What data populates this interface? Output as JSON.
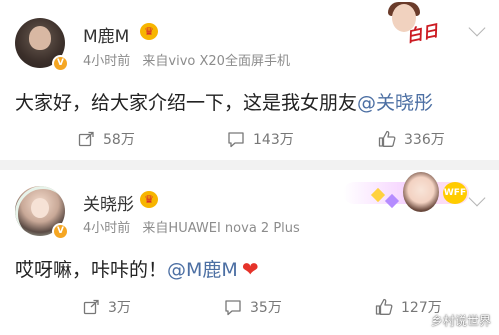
{
  "posts": [
    {
      "username": "M鹿M",
      "time": "4小时前",
      "source": "来自vivo X20全面屏手机",
      "content_text": "大家好，给大家介绍一下，这是我女朋友",
      "mention": "@关晓彤",
      "actions": {
        "repost": "58万",
        "comment": "143万",
        "like": "336万"
      },
      "badge": "V",
      "banner_text": "白日"
    },
    {
      "username": "关晓彤",
      "time": "4小时前",
      "source": "来自HUAWEI nova 2 Plus",
      "content_text": "哎呀嘛，咔咔的！",
      "mention": "@M鹿M",
      "actions": {
        "repost": "3万",
        "comment": "35万",
        "like": "127万"
      },
      "badge": "V",
      "banner_text": "WFF"
    }
  ],
  "watermark": "乡村说世界",
  "icons": {
    "verified": "verified-badge-icon",
    "crown": "crown-icon",
    "more": "chevron-down-icon",
    "repost": "repost-icon",
    "comment": "comment-icon",
    "like": "thumbs-up-icon",
    "heart": "heart-icon"
  },
  "colors": {
    "mention": "#4c6fa3",
    "heart": "#e5332a",
    "badge": "#f5a623"
  }
}
